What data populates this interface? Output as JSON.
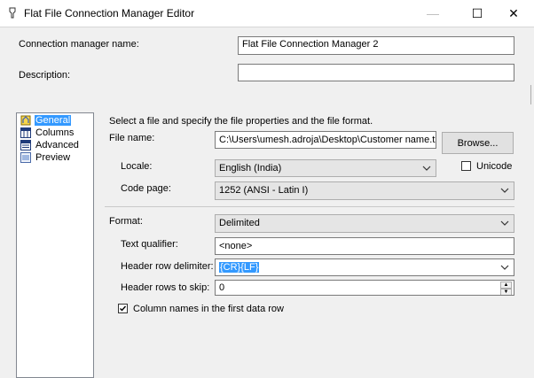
{
  "window": {
    "title": "Flat File Connection Manager Editor",
    "minimize_glyph": "—",
    "maximize_glyph": "☐",
    "close_glyph": "✕"
  },
  "connection": {
    "name_label": "Connection manager name:",
    "name_value": "Flat File Connection Manager 2",
    "description_label": "Description:",
    "description_value": ""
  },
  "nav": {
    "items": [
      {
        "label": "General",
        "icon": "general-icon",
        "selected": true
      },
      {
        "label": "Columns",
        "icon": "columns-icon",
        "selected": false
      },
      {
        "label": "Advanced",
        "icon": "advanced-icon",
        "selected": false
      },
      {
        "label": "Preview",
        "icon": "preview-icon",
        "selected": false
      }
    ]
  },
  "general": {
    "instruction": "Select a file and specify the file properties and the file format.",
    "file_name_label": "File name:",
    "file_name_value": "C:\\Users\\umesh.adroja\\Desktop\\Customer name.txt",
    "browse_label": "Browse...",
    "locale_label": "Locale:",
    "locale_value": "English (India)",
    "unicode_label": "Unicode",
    "code_page_label": "Code page:",
    "code_page_value": "1252  (ANSI - Latin I)",
    "format_label": "Format:",
    "format_value": "Delimited",
    "text_qualifier_label": "Text qualifier:",
    "text_qualifier_value": "<none>",
    "header_row_delimiter_label": "Header row delimiter:",
    "header_row_delimiter_value": "{CR}{LF}",
    "header_rows_skip_label": "Header rows to skip:",
    "header_rows_skip_value": "0",
    "column_names_label": "Column names in the first data row",
    "column_names_checked": true
  },
  "colors": {
    "selection": "#3399ff",
    "window_bg": "#f0f0f0"
  }
}
